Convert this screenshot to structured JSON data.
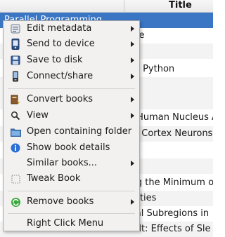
{
  "table": {
    "title_header": "Title",
    "selected_row_text": "Parallel Programming",
    "rows": [
      "nce",
      "",
      "ith Python",
      "",
      "",
      "",
      "e Human Nucleus A",
      "ce Cortex Neurons",
      "2]",
      "",
      "ing the Minimum o",
      "ntities",
      "ical Subregions in",
      "cult: Effects of Sle"
    ]
  },
  "menu": {
    "items": [
      {
        "label": "Edit metadata",
        "icon": "edit-metadata-icon",
        "submenu": true
      },
      {
        "label": "Send to device",
        "icon": "send-to-device-icon",
        "submenu": true
      },
      {
        "label": "Save to disk",
        "icon": "save-to-disk-icon",
        "submenu": true
      },
      {
        "label": "Connect/share",
        "icon": "connect-share-icon",
        "submenu": true
      },
      {
        "label": "Convert books",
        "icon": "convert-books-icon",
        "submenu": true
      },
      {
        "label": "View",
        "icon": "view-icon",
        "submenu": true
      },
      {
        "label": "Open containing folder",
        "icon": "folder-icon",
        "submenu": false
      },
      {
        "label": "Show book details",
        "icon": "info-icon",
        "submenu": false
      },
      {
        "label": "Similar books...",
        "icon": "",
        "submenu": true
      },
      {
        "label": "Tweak Book",
        "icon": "tweak-book-icon",
        "submenu": false
      },
      {
        "label": "Remove books",
        "icon": "recycle-icon",
        "submenu": true
      },
      {
        "label": "Right Click Menu",
        "icon": "",
        "submenu": false
      }
    ]
  },
  "colors": {
    "selection": "#3a76c4",
    "menu_bg": "#f2f1f0",
    "info_blue": "#2b6fd6",
    "recycle_green": "#2e9b2e"
  }
}
